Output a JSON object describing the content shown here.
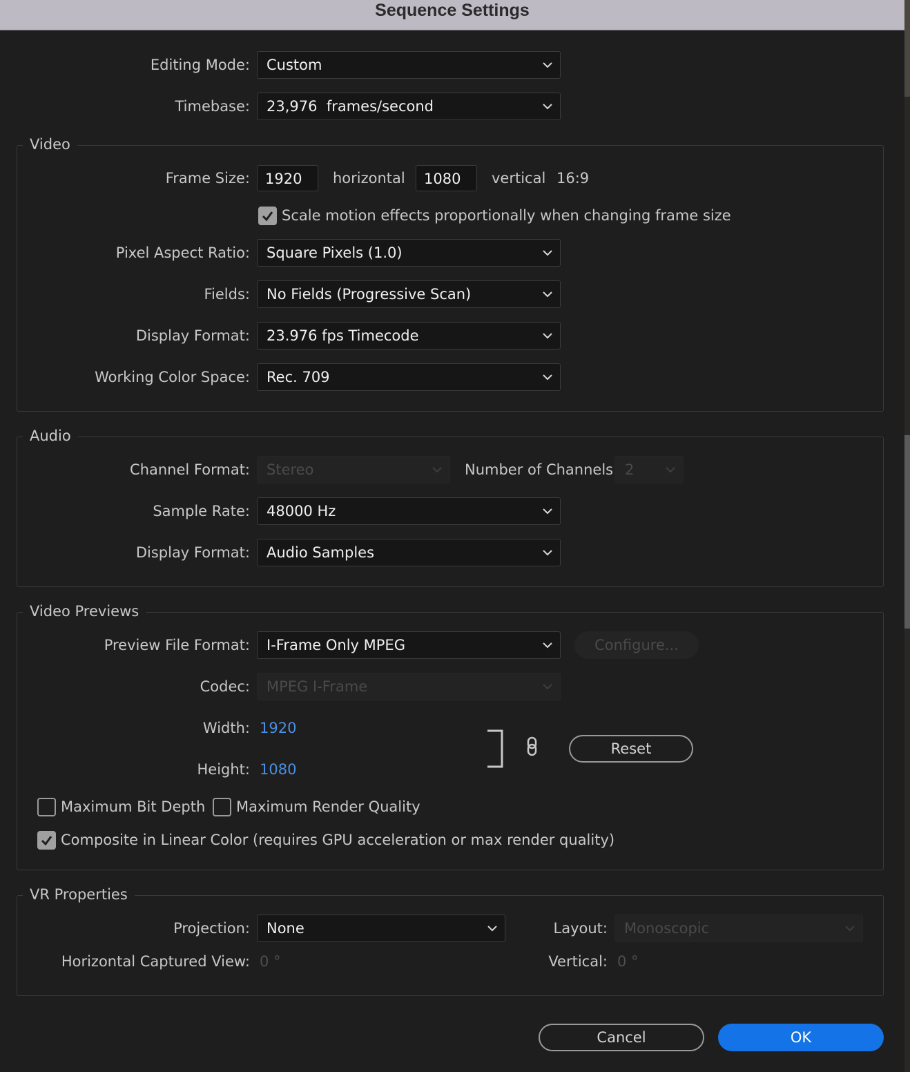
{
  "dialog": {
    "title": "Sequence Settings"
  },
  "general": {
    "editing_mode": {
      "label": "Editing Mode:",
      "value": "Custom"
    },
    "timebase": {
      "label": "Timebase:",
      "value": "23,976  frames/second"
    }
  },
  "video": {
    "legend": "Video",
    "frame_size": {
      "label": "Frame Size:",
      "horizontal": "1920",
      "horizontal_label": "horizontal",
      "vertical": "1080",
      "vertical_label": "vertical",
      "aspect": "16:9"
    },
    "scale_motion": {
      "label": "Scale motion effects proportionally when changing frame size",
      "checked": true
    },
    "pixel_aspect_ratio": {
      "label": "Pixel Aspect Ratio:",
      "value": "Square Pixels (1.0)"
    },
    "fields": {
      "label": "Fields:",
      "value": "No Fields (Progressive Scan)"
    },
    "display_format": {
      "label": "Display Format:",
      "value": "23.976 fps Timecode"
    },
    "working_color_space": {
      "label": "Working Color Space:",
      "value": "Rec. 709"
    }
  },
  "audio": {
    "legend": "Audio",
    "channel_format": {
      "label": "Channel Format:",
      "value": "Stereo"
    },
    "number_of_channels": {
      "label": "Number of Channels:",
      "value": "2"
    },
    "sample_rate": {
      "label": "Sample Rate:",
      "value": "48000 Hz"
    },
    "display_format": {
      "label": "Display Format:",
      "value": "Audio Samples"
    }
  },
  "video_previews": {
    "legend": "Video Previews",
    "preview_file_format": {
      "label": "Preview File Format:",
      "value": "I-Frame Only MPEG"
    },
    "configure_label": "Configure...",
    "codec": {
      "label": "Codec:",
      "value": "MPEG I-Frame"
    },
    "width": {
      "label": "Width:",
      "value": "1920"
    },
    "height": {
      "label": "Height:",
      "value": "1080"
    },
    "reset_label": "Reset",
    "max_bit_depth": {
      "label": "Maximum Bit Depth",
      "checked": false
    },
    "max_render_quality": {
      "label": "Maximum Render Quality",
      "checked": false
    },
    "composite_linear": {
      "label": "Composite in Linear Color (requires GPU acceleration or max render quality)",
      "checked": true
    }
  },
  "vr_properties": {
    "legend": "VR Properties",
    "projection": {
      "label": "Projection:",
      "value": "None"
    },
    "layout": {
      "label": "Layout:",
      "value": "Monoscopic"
    },
    "horizontal_captured_view": {
      "label": "Horizontal Captured View:",
      "value": "0 °"
    },
    "vertical": {
      "label": "Vertical:",
      "value": "0 °"
    }
  },
  "footer": {
    "cancel_label": "Cancel",
    "ok_label": "OK"
  },
  "colors": {
    "accent": "#1473e6",
    "link_value": "#4a90e2",
    "background": "#1e1e1e",
    "titlebar": "#bdbac4"
  },
  "icons": [
    "chevron-down-icon",
    "checkmark-icon",
    "chain-link-icon",
    "bracket-icon"
  ]
}
